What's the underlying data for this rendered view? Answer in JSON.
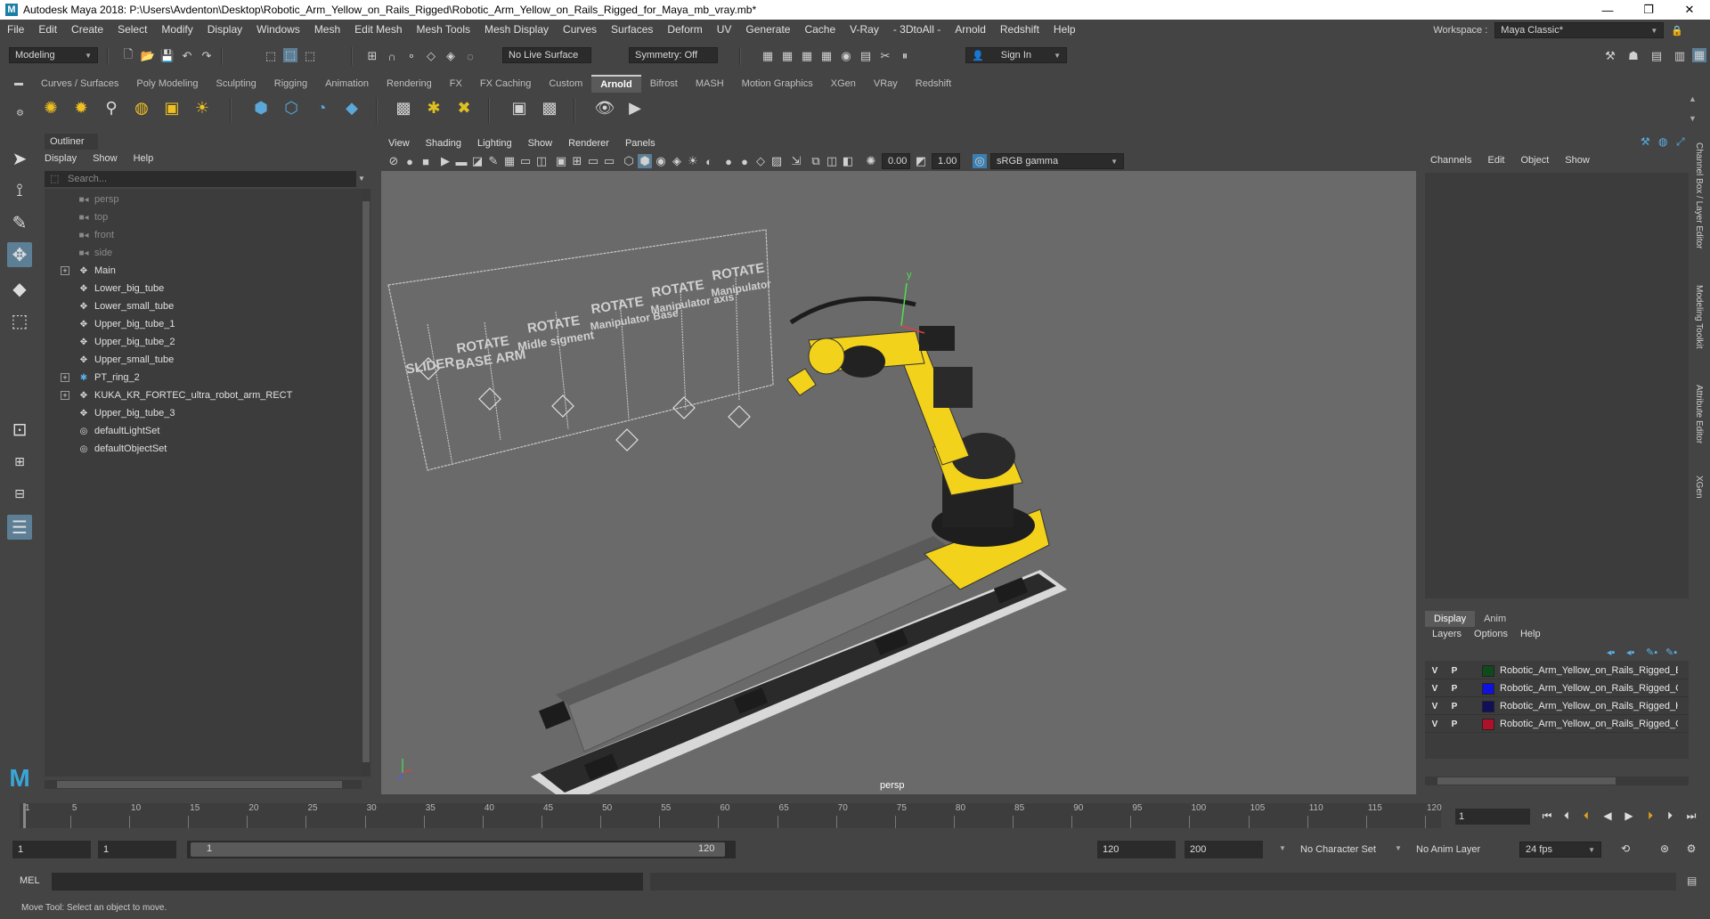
{
  "titlebar": {
    "title": "Autodesk Maya 2018: P:\\Users\\Avdenton\\Desktop\\Robotic_Arm_Yellow_on_Rails_Rigged\\Robotic_Arm_Yellow_on_Rails_Rigged_for_Maya_mb_vray.mb*",
    "logo_letter": "M",
    "minimize": "—",
    "restore": "❐",
    "close": "✕"
  },
  "menubar": {
    "items": [
      "File",
      "Edit",
      "Create",
      "Select",
      "Modify",
      "Display",
      "Windows",
      "Mesh",
      "Edit Mesh",
      "Mesh Tools",
      "Mesh Display",
      "Curves",
      "Surfaces",
      "Deform",
      "UV",
      "Generate",
      "Cache",
      "V-Ray",
      "- 3DtoAll -",
      "Arnold",
      "Redshift",
      "Help"
    ],
    "workspace_label": "Workspace :",
    "workspace_value": "Maya Classic*"
  },
  "statusline": {
    "menuset": "Modeling",
    "live_surface": "No Live Surface",
    "symmetry": "Symmetry: Off",
    "sign_in": "Sign In"
  },
  "shelf": {
    "tabs": [
      "Curves / Surfaces",
      "Poly Modeling",
      "Sculpting",
      "Rigging",
      "Animation",
      "Rendering",
      "FX",
      "FX Caching",
      "Custom",
      "Arnold",
      "Bifrost",
      "MASH",
      "Motion Graphics",
      "XGen",
      "VRay",
      "Redshift"
    ],
    "active_tab": "Arnold"
  },
  "outliner": {
    "title": "Outliner",
    "menu": [
      "Display",
      "Show",
      "Help"
    ],
    "search_placeholder": "Search...",
    "items": [
      {
        "label": "persp",
        "type": "camera",
        "dim": true,
        "expandable": false
      },
      {
        "label": "top",
        "type": "camera",
        "dim": true,
        "expandable": false
      },
      {
        "label": "front",
        "type": "camera",
        "dim": true,
        "expandable": false
      },
      {
        "label": "side",
        "type": "camera",
        "dim": true,
        "expandable": false
      },
      {
        "label": "Main",
        "type": "transform",
        "dim": false,
        "expandable": true
      },
      {
        "label": "Lower_big_tube",
        "type": "transform",
        "dim": false,
        "expandable": false
      },
      {
        "label": "Lower_small_tube",
        "type": "transform",
        "dim": false,
        "expandable": false
      },
      {
        "label": "Upper_big_tube_1",
        "type": "transform",
        "dim": false,
        "expandable": false
      },
      {
        "label": "Upper_big_tube_2",
        "type": "transform",
        "dim": false,
        "expandable": false
      },
      {
        "label": "Upper_small_tube",
        "type": "transform",
        "dim": false,
        "expandable": false
      },
      {
        "label": "PT_ring_2",
        "type": "joint",
        "dim": false,
        "expandable": true
      },
      {
        "label": "KUKA_KR_FORTEC_ultra_robot_arm_RECT",
        "type": "transform",
        "dim": false,
        "expandable": true
      },
      {
        "label": "Upper_big_tube_3",
        "type": "transform",
        "dim": false,
        "expandable": false
      },
      {
        "label": "defaultLightSet",
        "type": "set",
        "dim": false,
        "expandable": false
      },
      {
        "label": "defaultObjectSet",
        "type": "set",
        "dim": false,
        "expandable": false
      }
    ]
  },
  "viewport": {
    "menu": [
      "View",
      "Shading",
      "Lighting",
      "Show",
      "Renderer",
      "Panels"
    ],
    "exposure": "0.00",
    "gamma": "1.00",
    "color_space": "sRGB gamma",
    "camera_label": "persp",
    "rig_labels": [
      {
        "title": "SLIDER",
        "sub": ""
      },
      {
        "title": "ROTATE",
        "sub": "BASE ARM"
      },
      {
        "title": "ROTATE",
        "sub": "Midle sigment"
      },
      {
        "title": "ROTATE",
        "sub": "Manipulator Base"
      },
      {
        "title": "ROTATE",
        "sub": "Manipulator axis"
      },
      {
        "title": "ROTATE",
        "sub": "Manipulator"
      }
    ],
    "axis_y": "y"
  },
  "channelbox": {
    "menu": [
      "Channels",
      "Edit",
      "Object",
      "Show"
    ]
  },
  "layers": {
    "tabs": [
      "Display",
      "Anim"
    ],
    "active_tab": "Display",
    "menu": [
      "Layers",
      "Options",
      "Help"
    ],
    "rows": [
      {
        "v": "V",
        "p": "P",
        "color": "#0f4a1c",
        "name": "Robotic_Arm_Yellow_on_Rails_Rigged_B"
      },
      {
        "v": "V",
        "p": "P",
        "color": "#1010e0",
        "name": "Robotic_Arm_Yellow_on_Rails_Rigged_C"
      },
      {
        "v": "V",
        "p": "P",
        "color": "#10105a",
        "name": "Robotic_Arm_Yellow_on_Rails_Rigged_H"
      },
      {
        "v": "V",
        "p": "P",
        "color": "#b0102a",
        "name": "Robotic_Arm_Yellow_on_Rails_Rigged_C"
      }
    ]
  },
  "side_tabs": [
    "Channel Box / Layer Editor",
    "Modeling Toolkit",
    "Attribute Editor",
    "XGen"
  ],
  "timeslider": {
    "ticks": [
      "1",
      "5",
      "10",
      "15",
      "20",
      "25",
      "30",
      "35",
      "40",
      "45",
      "50",
      "55",
      "60",
      "65",
      "70",
      "75",
      "80",
      "85",
      "90",
      "95",
      "100",
      "105",
      "110",
      "115",
      "120"
    ],
    "current_frame": "1"
  },
  "range": {
    "start": "1",
    "anim_start": "1",
    "range_start": "1",
    "range_end": "120",
    "anim_end": "120",
    "end": "200",
    "character_set": "No Character Set",
    "anim_layer": "No Anim Layer",
    "fps": "24 fps"
  },
  "cmdline": {
    "label": "MEL"
  },
  "helpline": {
    "text": "Move Tool: Select an object to move."
  },
  "colors": {
    "robot_yellow": "#f2d21a",
    "ui_bg": "#444444",
    "viewport_bg": "#6a6a6a",
    "active_tool": "#5d7f96"
  }
}
